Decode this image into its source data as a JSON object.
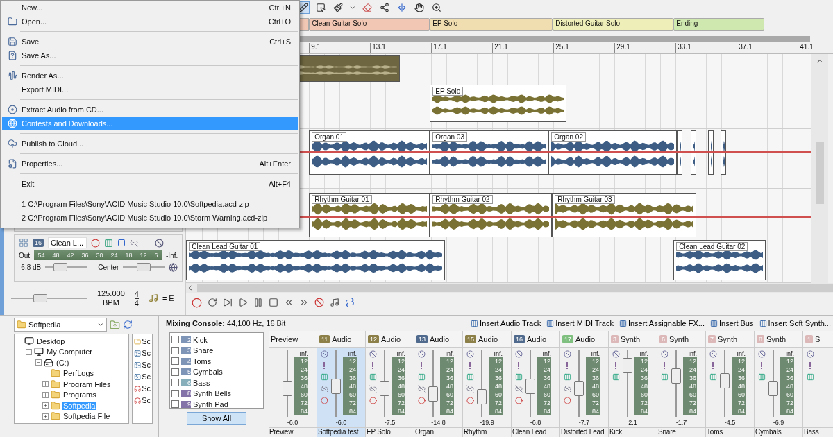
{
  "file_menu": {
    "items": [
      {
        "kind": "item",
        "label": "New...",
        "shortcut": "Ctrl+N",
        "selected": false
      },
      {
        "kind": "item",
        "label": "Open...",
        "shortcut": "Ctrl+O",
        "selected": false
      },
      {
        "kind": "separator"
      },
      {
        "kind": "item",
        "label": "Save",
        "shortcut": "Ctrl+S",
        "selected": false
      },
      {
        "kind": "item",
        "label": "Save As...",
        "selected": false
      },
      {
        "kind": "separator"
      },
      {
        "kind": "item",
        "label": "Render As...",
        "selected": false
      },
      {
        "kind": "item",
        "label": "Export MIDI...",
        "selected": false
      },
      {
        "kind": "separator"
      },
      {
        "kind": "item",
        "label": "Extract Audio from CD...",
        "selected": false
      },
      {
        "kind": "item",
        "label": "Contests and Downloads...",
        "selected": true
      },
      {
        "kind": "separator"
      },
      {
        "kind": "item",
        "label": "Publish to Cloud...",
        "selected": false
      },
      {
        "kind": "separator"
      },
      {
        "kind": "item",
        "label": "Properties...",
        "shortcut": "Alt+Enter",
        "selected": false
      },
      {
        "kind": "separator"
      },
      {
        "kind": "item",
        "label": "Exit",
        "shortcut": "Alt+F4",
        "selected": false
      },
      {
        "kind": "separator"
      },
      {
        "kind": "item",
        "label": "1 C:\\Program Files\\Sony\\ACID Music Studio 10.0\\Softpedia.acd-zip",
        "selected": false
      },
      {
        "kind": "item",
        "label": "2 C:\\Program Files\\Sony\\ACID Music Studio 10.0\\Storm Warning.acd-zip",
        "selected": false
      }
    ]
  },
  "markers": [
    {
      "label": "Clean Guitar Solo",
      "color": "#f2c7b4"
    },
    {
      "label": "EP Solo",
      "color": "#f1deb0"
    },
    {
      "label": "Distorted Guitar Solo",
      "color": "#eeeeb8"
    },
    {
      "label": "Ending",
      "color": "#cfe8b0"
    }
  ],
  "ruler": [
    "9.1",
    "13.1",
    "17.1",
    "21.1",
    "25.1",
    "29.1",
    "33.1",
    "37.1",
    "41.1"
  ],
  "tracks": [
    {
      "color": "#6e6640",
      "clips": [
        {
          "kind": "clip"
        }
      ]
    },
    {
      "color": "#7a7234",
      "clips": [
        {
          "kind": "clip",
          "name": "EP Solo"
        }
      ]
    },
    {
      "color": "#3d5d85",
      "clips": [
        {
          "kind": "clip",
          "name": "Organ 01"
        },
        {
          "kind": "clip",
          "name": "Organ 03"
        },
        {
          "kind": "clip",
          "name": "Organ 02"
        },
        {
          "kind": "clip"
        },
        {
          "kind": "clip"
        },
        {
          "kind": "clip"
        },
        {
          "kind": "clip"
        }
      ]
    },
    {
      "color": "#7a7234",
      "clips": [
        {
          "kind": "clip",
          "name": "Rhythm Guitar 01"
        },
        {
          "kind": "clip",
          "name": "Rhythm Guitar 02"
        },
        {
          "kind": "clip",
          "name": "Rhythm Guitar 03"
        }
      ]
    },
    {
      "color": "#3d5d85",
      "clips": [
        {
          "kind": "clip",
          "name": "Clean Lead Guitar 01"
        },
        {
          "kind": "clip",
          "name": "Clean Lead Guitar 02"
        }
      ]
    }
  ],
  "track_header": {
    "number": "16",
    "name": "Clean L...",
    "out": "Out",
    "meter_scale": [
      "54",
      "48",
      "42",
      "36",
      "30",
      "24",
      "18",
      "12",
      "6"
    ],
    "peak": "-Inf.",
    "volume": {
      "text": "-6.8 dB",
      "level": 0.3
    },
    "pan": {
      "text": "Center",
      "level": 0.5
    }
  },
  "tempo": {
    "level": 0.35,
    "bpm": "125.000",
    "unit": "BPM",
    "beats": "4",
    "note": "4",
    "key": "= E"
  },
  "explorer": {
    "folder": "Softpedia",
    "tree": [
      {
        "label": "Desktop",
        "selected": false,
        "children": [
          {
            "label": "My Computer",
            "expanded": true,
            "selected": false,
            "children": [
              {
                "label": "(C:)",
                "expanded": true,
                "selected": false,
                "children": [
                  {
                    "label": "PerfLogs",
                    "selected": false
                  },
                  {
                    "label": "Program Files",
                    "expanded": false,
                    "selected": false
                  },
                  {
                    "label": "Programs",
                    "expanded": false,
                    "selected": false
                  },
                  {
                    "label": "Softpedia",
                    "expanded": false,
                    "selected": true
                  },
                  {
                    "label": "Softpedia File",
                    "expanded": false,
                    "selected": false
                  }
                ]
              }
            ]
          }
        ]
      }
    ],
    "files": [
      {
        "kind": "folder",
        "label": "Sc"
      },
      {
        "kind": "image",
        "label": "Sc"
      },
      {
        "kind": "image",
        "label": "Sc"
      },
      {
        "kind": "image",
        "label": "Sc"
      },
      {
        "kind": "audio",
        "label": "Sc"
      },
      {
        "kind": "audio",
        "label": "Sc"
      }
    ]
  },
  "mixer": {
    "title": "**Mixing Console:** 44,100 Hz, 16 Bit",
    "toolbar": [
      "Insert Audio Track",
      "Insert MIDI Track",
      "Insert Assignable FX...",
      "Insert Bus",
      "Insert Soft Synth..."
    ],
    "track_list": [
      {
        "number": "2",
        "label": "Kick",
        "checked": false,
        "color": "#7f95b8"
      },
      {
        "number": "3",
        "label": "Snare",
        "checked": false,
        "color": "#7f95b8"
      },
      {
        "number": "4",
        "label": "Toms",
        "checked": false,
        "color": "#7f95b8"
      },
      {
        "number": "5",
        "label": "Cymbals",
        "checked": false,
        "color": "#7f95b8"
      },
      {
        "number": "6",
        "label": "Bass",
        "checked": false,
        "color": "#86aebb"
      },
      {
        "number": "8",
        "label": "Synth Bells",
        "checked": false,
        "color": "#8473a8"
      },
      {
        "number": "9",
        "label": "Synth Pad",
        "checked": false,
        "color": "#8473a8"
      }
    ],
    "show_all": "Show All",
    "channels": [
      {
        "kind": "preview",
        "type": "Preview",
        "name": "Preview",
        "value": "-6.0",
        "level": 0.4,
        "selected": false,
        "peak": "-Inf.",
        "scale": [
          "12",
          "24",
          "36",
          "48",
          "60",
          "72",
          "84"
        ]
      },
      {
        "kind": "audio",
        "number": "11",
        "color": "#8c8048",
        "type": "Audio",
        "name": "Softpedia test",
        "value": "-6.0",
        "level": 0.45,
        "selected": true,
        "peak": "-Inf.",
        "scale": [
          "12",
          "24",
          "36",
          "48",
          "60",
          "72",
          "84"
        ]
      },
      {
        "kind": "audio",
        "number": "12",
        "color": "#8c8048",
        "type": "Audio",
        "name": "EP Solo",
        "value": "-7.5",
        "level": 0.4,
        "selected": false,
        "peak": "-Inf.",
        "scale": [
          "12",
          "24",
          "36",
          "48",
          "60",
          "72",
          "84"
        ]
      },
      {
        "kind": "audio",
        "number": "13",
        "color": "#4f6a8c",
        "type": "Audio",
        "name": "Organ",
        "value": "-14.8",
        "level": 0.3,
        "selected": false,
        "peak": "-Inf.",
        "scale": [
          "12",
          "24",
          "36",
          "48",
          "60",
          "72",
          "84"
        ]
      },
      {
        "kind": "audio",
        "number": "15",
        "color": "#8c8048",
        "type": "Audio",
        "name": "Rhythm",
        "value": "-19.9",
        "level": 0.25,
        "selected": false,
        "peak": "-Inf.",
        "scale": [
          "12",
          "24",
          "36",
          "48",
          "60",
          "72",
          "84"
        ]
      },
      {
        "kind": "audio",
        "number": "16",
        "color": "#4f6a8c",
        "type": "Audio",
        "name": "Clean Lead",
        "value": "-6.8",
        "level": 0.45,
        "selected": false,
        "peak": "-Inf.",
        "scale": [
          "12",
          "24",
          "36",
          "48",
          "60",
          "72",
          "84"
        ]
      },
      {
        "kind": "audio",
        "number": "17",
        "color": "#7fbf7f",
        "type": "Audio",
        "name": "Distorted Lead",
        "value": "-7.7",
        "level": 0.4,
        "selected": false,
        "peak": "-Inf.",
        "scale": [
          "12",
          "24",
          "36",
          "48",
          "60",
          "72",
          "84"
        ]
      },
      {
        "kind": "synth",
        "number": "3",
        "color": "#dcb8b8",
        "type": "Synth",
        "name": "Kick",
        "value": "2.1",
        "level": 0.85,
        "selected": false,
        "peak": "-Inf.",
        "scale": [
          "12",
          "24",
          "36",
          "48",
          "60",
          "72",
          "84"
        ]
      },
      {
        "kind": "synth",
        "number": "6",
        "color": "#dcb8b8",
        "type": "Synth",
        "name": "Snare",
        "value": "-1.7",
        "level": 0.65,
        "selected": false,
        "peak": "-Inf.",
        "scale": [
          "12",
          "24",
          "36",
          "48",
          "60",
          "72",
          "84"
        ]
      },
      {
        "kind": "synth",
        "number": "7",
        "color": "#dcb8b8",
        "type": "Synth",
        "name": "Toms",
        "value": "-4.5",
        "level": 0.55,
        "selected": false,
        "peak": "-Inf.",
        "scale": [
          "12",
          "24",
          "36",
          "48",
          "60",
          "72",
          "84"
        ]
      },
      {
        "kind": "synth",
        "number": "8",
        "color": "#dcb8b8",
        "type": "Synth",
        "name": "Cymbals",
        "value": "-6.9",
        "level": 0.4,
        "selected": false,
        "peak": "-Inf.",
        "scale": [
          "12",
          "24",
          "36",
          "48",
          "60",
          "72",
          "84"
        ]
      },
      {
        "kind": "synth",
        "number": "1",
        "color": "#dcb8b8",
        "type": "S",
        "name": "Bass",
        "selected": false
      }
    ]
  }
}
